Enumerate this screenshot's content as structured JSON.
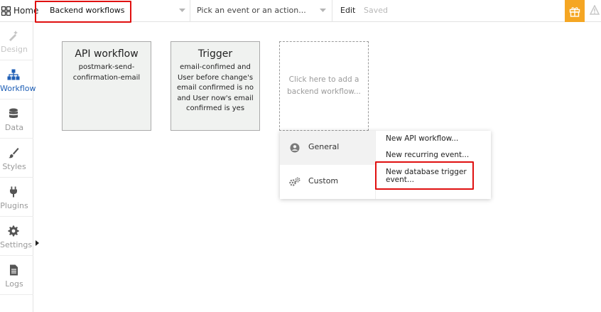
{
  "topbar": {
    "home_label": "Home",
    "page_select": "Backend workflows",
    "event_select_placeholder": "Pick an event or an action...",
    "edit_label": "Edit",
    "saved_label": "Saved"
  },
  "sidebar": {
    "items": [
      {
        "label": "Design",
        "icon": "design-icon"
      },
      {
        "label": "Workflow",
        "icon": "workflow-icon"
      },
      {
        "label": "Data",
        "icon": "database-icon"
      },
      {
        "label": "Styles",
        "icon": "brush-icon"
      },
      {
        "label": "Plugins",
        "icon": "plug-icon"
      },
      {
        "label": "Settings",
        "icon": "gear-icon"
      },
      {
        "label": "Logs",
        "icon": "document-icon"
      }
    ]
  },
  "canvas": {
    "cards": [
      {
        "title": "API workflow",
        "subtitle": "postmark-send-confirmation-email"
      },
      {
        "title": "Trigger",
        "subtitle": "email-confimed and User before change's email confirmed is no and User now's email confirmed is yes"
      }
    ],
    "add_card_text": "Click here to add a backend workflow..."
  },
  "menu": {
    "categories": [
      {
        "label": "General",
        "icon": "user-circle-icon"
      },
      {
        "label": "Custom",
        "icon": "gears-icon"
      }
    ],
    "options": [
      {
        "label": "New API workflow..."
      },
      {
        "label": "New recurring event..."
      },
      {
        "label": "New database trigger event..."
      }
    ]
  },
  "colors": {
    "accent_blue": "#1f5fb6",
    "highlight_red": "#e01010",
    "gift_orange": "#f5a623"
  }
}
